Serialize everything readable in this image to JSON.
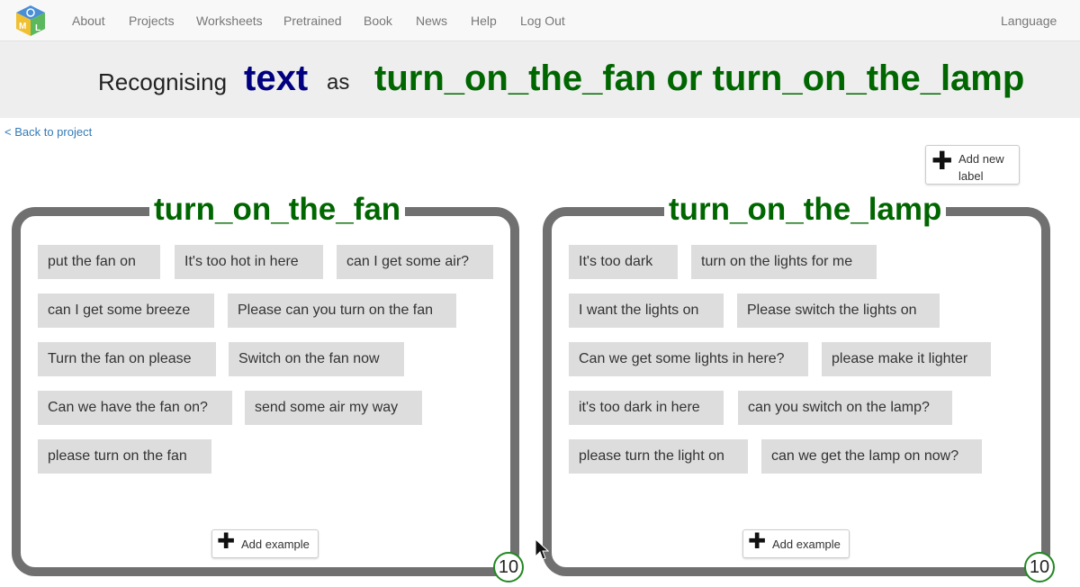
{
  "nav": {
    "items": [
      "About",
      "Projects",
      "Worksheets",
      "Pretrained",
      "Book",
      "News",
      "Help",
      "Log Out"
    ],
    "language": "Language"
  },
  "header": {
    "recognising": "Recognising",
    "data_type": "text",
    "as": "as",
    "labels_text": "turn_on_the_fan or turn_on_the_lamp"
  },
  "back_link": "< Back to project",
  "add_label": {
    "line1": "Add new",
    "line2": "label"
  },
  "buckets": [
    {
      "label": "turn_on_the_fan",
      "examples": [
        "put the fan on",
        "It's too hot in here",
        "can I get some air?",
        "can I get some breeze",
        "Please can you turn on the fan",
        "Turn the fan on please",
        "Switch on the fan now",
        "Can we have the fan on?",
        "send some air my way",
        "please turn on the fan"
      ],
      "add_example": "Add example",
      "count": "10"
    },
    {
      "label": "turn_on_the_lamp",
      "examples": [
        "It's too dark",
        "turn on the lights for me",
        "I want the lights on",
        "Please switch the lights on",
        "Can we get some lights in here?",
        "please make it lighter",
        "it's too dark in here",
        "can you switch on the lamp?",
        "please turn the light on",
        "can we get the lamp on now?"
      ],
      "add_example": "Add example",
      "count": "10"
    }
  ],
  "colors": {
    "label_green": "#006600",
    "data_type_navy": "#000080",
    "panel_border": "#707070",
    "chip_bg": "#dddddd",
    "link": "#337ab7"
  }
}
